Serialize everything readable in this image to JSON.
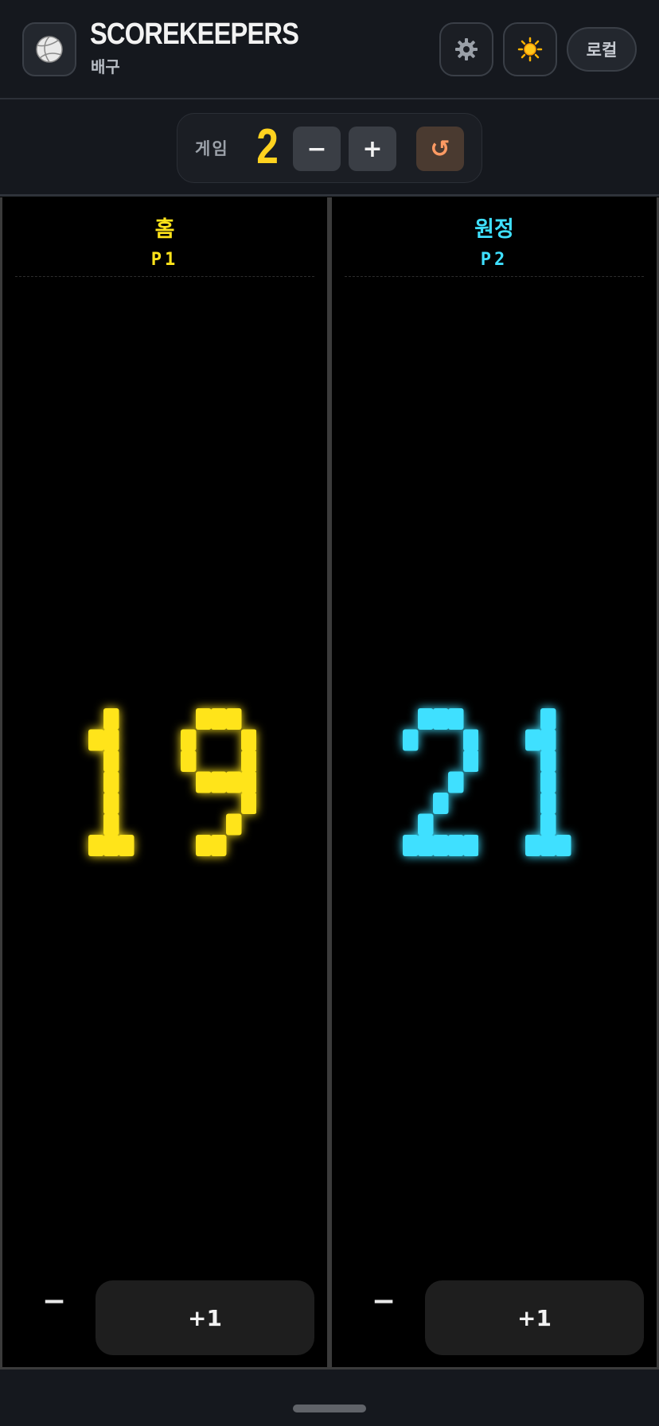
{
  "header": {
    "title": "SCOREKEEPERS",
    "subtitle": "배구",
    "local_label": "로컬",
    "icons": {
      "logo": "volleyball-icon",
      "settings": "gear-icon",
      "theme": "sun-icon"
    }
  },
  "game": {
    "label": "게임",
    "number": "2",
    "decrement_label": "−",
    "increment_label": "+",
    "reset_label": "↺"
  },
  "teams": [
    {
      "name": "홈",
      "player": "P1",
      "score": "19",
      "color": "#ffe41a",
      "minus_label": "−",
      "plus_label": "+1"
    },
    {
      "name": "원정",
      "player": "P2",
      "score": "21",
      "color": "#3fe0ff",
      "minus_label": "−",
      "plus_label": "+1"
    }
  ],
  "colors": {
    "accent_game": "#ffd21f",
    "reset_accent": "#ff9a63",
    "header_bg": "#15181e"
  }
}
